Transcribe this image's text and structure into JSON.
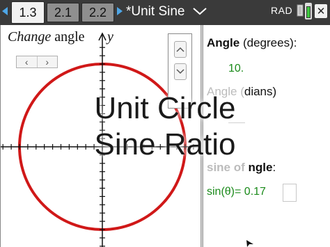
{
  "tabs": [
    {
      "label": "1.3",
      "active": true
    },
    {
      "label": "2.1",
      "active": false
    },
    {
      "label": "2.2",
      "active": false
    }
  ],
  "document": {
    "title": "*Unit Sine"
  },
  "status": {
    "mode": "RAD",
    "battery_icon": "battery-icon"
  },
  "graph": {
    "change_word": "Change",
    "angle_word": "angle",
    "y_axis_label": "y",
    "circle_color": "#d01818"
  },
  "notes": {
    "angle_label": "Angle",
    "angle_units": "(degrees):",
    "angle_value": "10.",
    "radians_partial_faded": "Angle (",
    "radians_partial": "dians)",
    "sine_faded": "sine of ",
    "sine_bold": "ngle",
    "sine_colon": ":",
    "formula": "sin(θ)= 0.17",
    "value_color": "#1a8a1a"
  },
  "overlay": {
    "line1": "Unit Circle",
    "line2": "Sine Ratio"
  }
}
